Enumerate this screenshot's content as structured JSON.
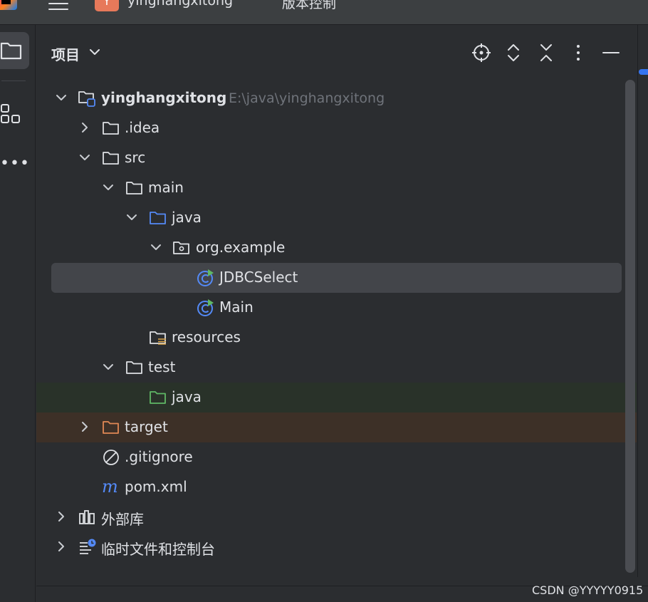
{
  "titlebar": {
    "project_avatar": "Y",
    "project_name": "yinghangxitong",
    "vcs_label": "版本控制"
  },
  "panel": {
    "title": "项目",
    "header_icons": [
      "crosshair-icon",
      "expand-all-icon",
      "collapse-all-icon",
      "more-vertical-icon",
      "minimize-icon"
    ]
  },
  "tree": {
    "root_name": "yinghangxitong",
    "root_path": "E:\\java\\yinghangxitong",
    "idea": ".idea",
    "src": "src",
    "main": "main",
    "main_java": "java",
    "package": "org.example",
    "class_jdbc": "JDBCSelect",
    "class_main": "Main",
    "resources": "resources",
    "test": "test",
    "test_java": "java",
    "target": "target",
    "gitignore": ".gitignore",
    "pom": "pom.xml",
    "external_libs": "外部库",
    "scratches": "临时文件和控制台"
  },
  "colors": {
    "background": "#2b2d30",
    "selection": "#43454a",
    "folder_source": "#548af7",
    "folder_test": "#5fb865",
    "folder_excluded": "#e08855",
    "java_class": "#548af7"
  },
  "watermark": "CSDN @YYYYY0915"
}
